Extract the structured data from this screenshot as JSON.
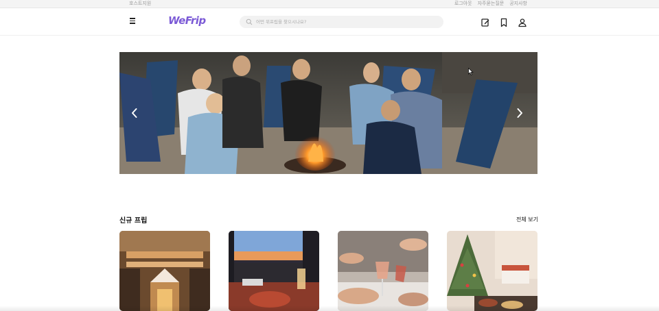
{
  "topbar": {
    "host_center": "호스트지원",
    "links": [
      "로그아웃",
      "자주묻는질문",
      "공지사항"
    ]
  },
  "header": {
    "logo": "WeFrip",
    "search_placeholder": "어떤 위프립을 찾으시나요?",
    "icons": [
      "menu-icon",
      "search-icon",
      "edit-icon",
      "bookmark-icon",
      "user-icon"
    ]
  },
  "banner": {
    "prev_icon": "chevron-left-icon",
    "next_icon": "chevron-right-icon"
  },
  "new_trips": {
    "title": "신규 프립",
    "see_all": "전체 보기",
    "cards": [
      {
        "image": "indoor-market-photo"
      },
      {
        "image": "sunset-picnic-photo"
      },
      {
        "image": "wine-toast-photo"
      },
      {
        "image": "christmas-party-photo"
      }
    ]
  },
  "colors": {
    "brand": "#7b5ad6",
    "topbar_bg": "#f4f4f4",
    "search_bg": "#f2f2f2"
  }
}
